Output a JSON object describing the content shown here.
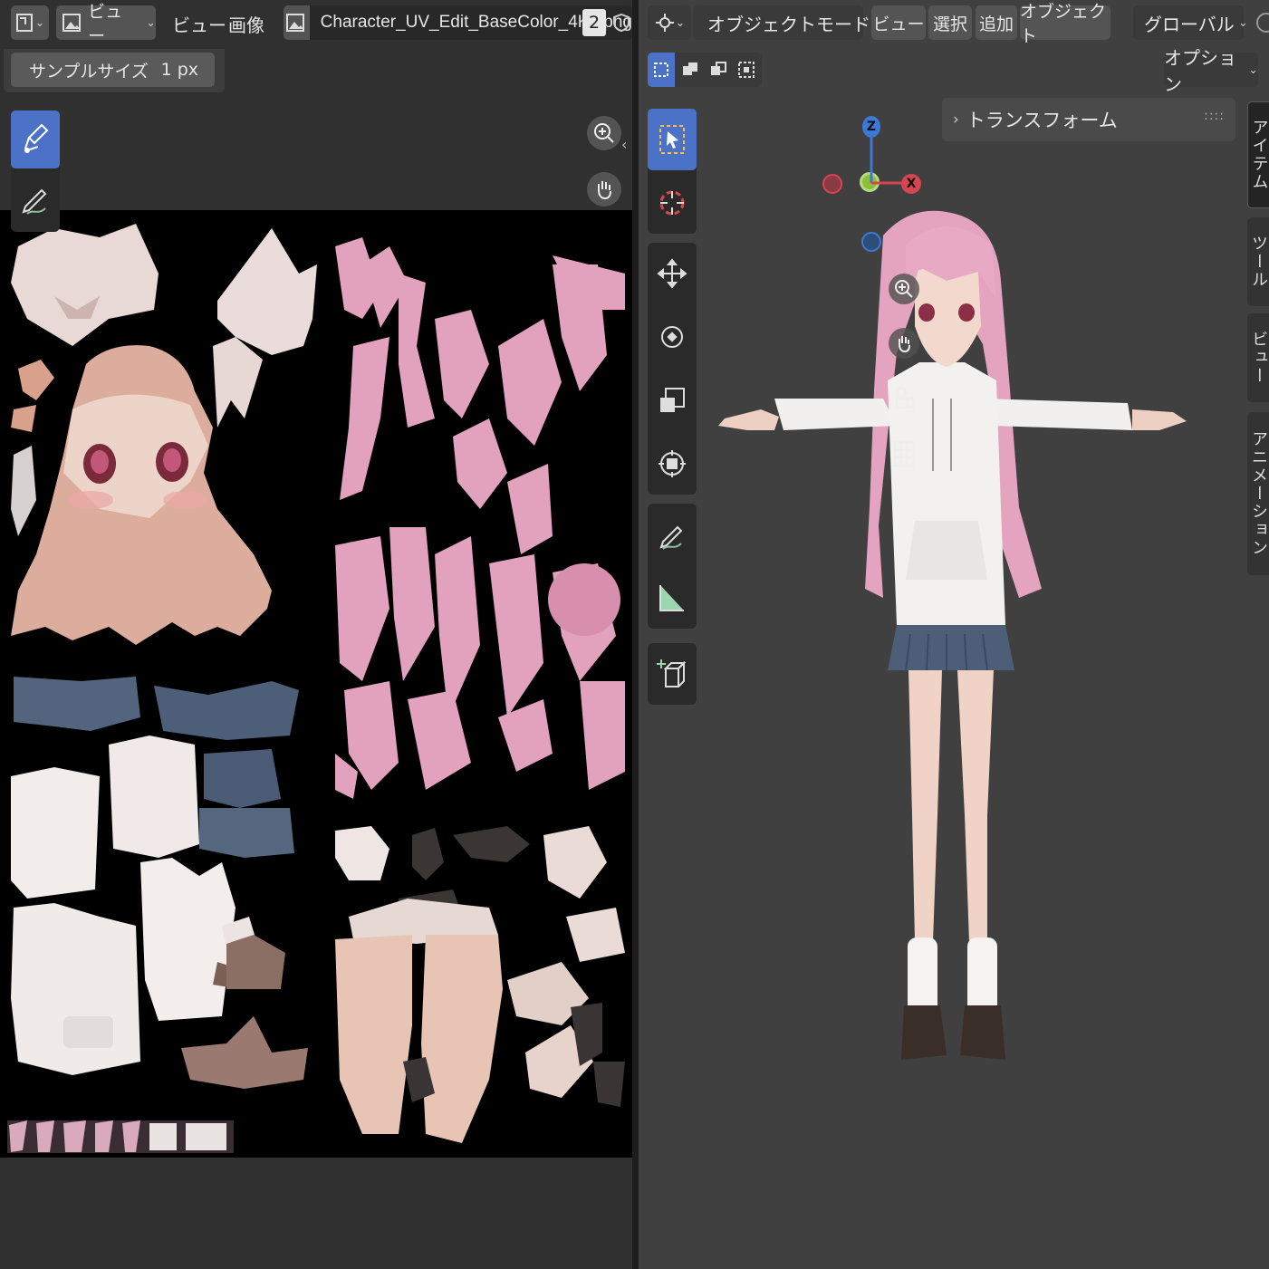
{
  "image_editor": {
    "header": {
      "view_menu": "ビュー",
      "image_menu": "画像",
      "editor_label": "ビュー",
      "image_name": "Character_UV_Edit_BaseColor_4K2.png",
      "user_count": "2"
    },
    "sample_size": {
      "label": "サンプルサイズ",
      "value": "1 px"
    }
  },
  "viewport": {
    "header": {
      "mode": "オブジェクトモード",
      "menu_view": "ビュー",
      "menu_select": "選択",
      "menu_add": "追加",
      "menu_object": "オブジェクト",
      "orientation": "グローバル"
    },
    "options": "オプション",
    "transform_panel": "トランスフォーム",
    "gizmo": {
      "z": "Z",
      "x": "X"
    },
    "sidebar_tabs": [
      "アイテム",
      "ツール",
      "ビュー",
      "アニメーション"
    ]
  },
  "colors": {
    "accent": "#4b72c7",
    "header_bg": "#303030",
    "button_bg": "#545454",
    "hair_pink": "#e4a3bf",
    "skirt_blue": "#4d5e79",
    "axis_x": "#d64550",
    "axis_z": "#3c79d6",
    "axis_y": "#8dbf35"
  }
}
